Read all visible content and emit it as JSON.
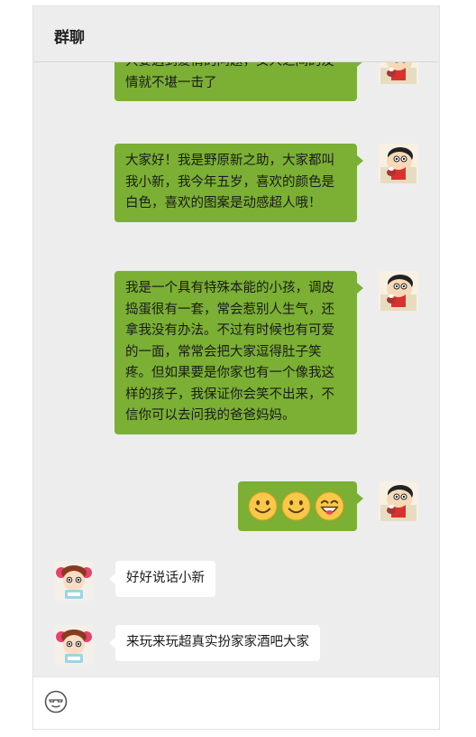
{
  "header": {
    "title": "群聊"
  },
  "messages": [
    {
      "side": "me",
      "text": "只要遇到爱情的问题，女人之间的友情就不堪一击了"
    },
    {
      "side": "me",
      "text": "大家好！我是野原新之助，大家都叫我小新，我今年五岁，喜欢的颜色是白色，喜欢的图案是动感超人哦！"
    },
    {
      "side": "me",
      "text": "我是一个具有特殊本能的小孩，调皮捣蛋很有一套，常会惹别人生气，还拿我没有办法。不过有时候也有可爱的一面，常常会把大家逗得肚子笑疼。但如果要是你家也有一个像我这样的孩子，我保证你会笑不出来，不信你可以去问我的爸爸妈妈。"
    },
    {
      "side": "me",
      "emojis": [
        "smile-emoji",
        "smile-emoji",
        "grin-emoji"
      ]
    },
    {
      "side": "other",
      "text": "好好说话小新"
    },
    {
      "side": "other",
      "text": "来玩来玩超真实扮家家酒吧大家"
    }
  ],
  "colors": {
    "my_bubble": "#7bb034",
    "other_bubble": "#ffffff",
    "background": "#ededed"
  },
  "footer": {
    "icon": "emoji-icon"
  }
}
